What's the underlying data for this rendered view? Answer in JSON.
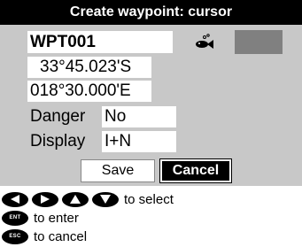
{
  "dialog": {
    "title": "Create waypoint: cursor"
  },
  "waypoint": {
    "name": "WPT001",
    "latitude": "33°45.023'S",
    "longitude": "018°30.000'E",
    "symbol_icon": "fish-icon",
    "color": "#808080"
  },
  "fields": {
    "danger_label": "Danger",
    "danger_value": "No",
    "display_label": "Display",
    "display_value": "I+N"
  },
  "buttons": {
    "save_label": "Save",
    "cancel_label": "Cancel"
  },
  "help": {
    "select_text": "to select",
    "enter_key_label": "ENT",
    "enter_text": "to enter",
    "cancel_key_label": "ESC",
    "cancel_text": "to cancel",
    "arrow_keys": [
      "left-arrow-key-icon",
      "right-arrow-key-icon",
      "up-arrow-key-icon",
      "down-arrow-key-icon"
    ]
  }
}
